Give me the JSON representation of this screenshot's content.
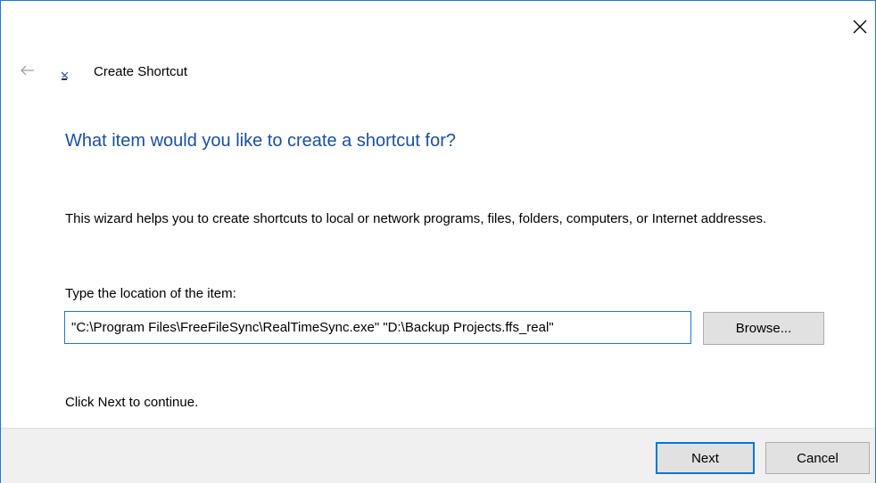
{
  "window": {
    "title": "Create Shortcut",
    "close_icon": "close-icon",
    "back_icon": "back-arrow-icon",
    "app_icon": "shortcut-wizard-icon"
  },
  "main": {
    "heading": "What item would you like to create a shortcut for?",
    "description": "This wizard helps you to create shortcuts to local or network programs, files, folders, computers, or Internet addresses.",
    "location_label": "Type the location of the item:",
    "location_value": "\"C:\\Program Files\\FreeFileSync\\RealTimeSync.exe\" \"D:\\Backup Projects.ffs_real\"",
    "browse_label": "Browse...",
    "continue_text": "Click Next to continue."
  },
  "footer": {
    "next_label": "Next",
    "cancel_label": "Cancel"
  },
  "colors": {
    "heading": "#1a4fa0",
    "accent_border": "#1e78d7",
    "button_bg": "#e1e1e1",
    "footer_bg": "#f0f0f0"
  }
}
